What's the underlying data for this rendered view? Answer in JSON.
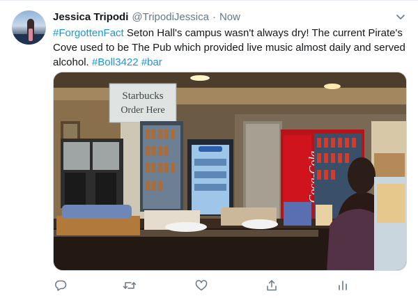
{
  "tweet": {
    "author_name": "Jessica Tripodi",
    "author_handle": "@TripodiJessica",
    "separator": "·",
    "timestamp": "Now",
    "text_parts": [
      {
        "type": "hashtag",
        "text": "#ForgottenFact"
      },
      {
        "type": "text",
        "text": " Seton Hall's campus wasn't always dry! The current Pirate's Cove used to be The Pub which provided live music almost daily and served alcohol. "
      },
      {
        "type": "hashtag",
        "text": "#Boll3422"
      },
      {
        "type": "text",
        "text": " "
      },
      {
        "type": "hashtag",
        "text": "#bar"
      }
    ],
    "image": {
      "sign_line1": "Starbucks",
      "sign_line2": "Order Here",
      "cooler_brand": "Coca-Cola"
    },
    "actions": [
      "reply-icon",
      "retweet-icon",
      "like-icon",
      "share-icon",
      "analytics-icon"
    ]
  },
  "colors": {
    "hashtag": "#1b95e0",
    "icon": "#657786",
    "name": "#14171a"
  }
}
